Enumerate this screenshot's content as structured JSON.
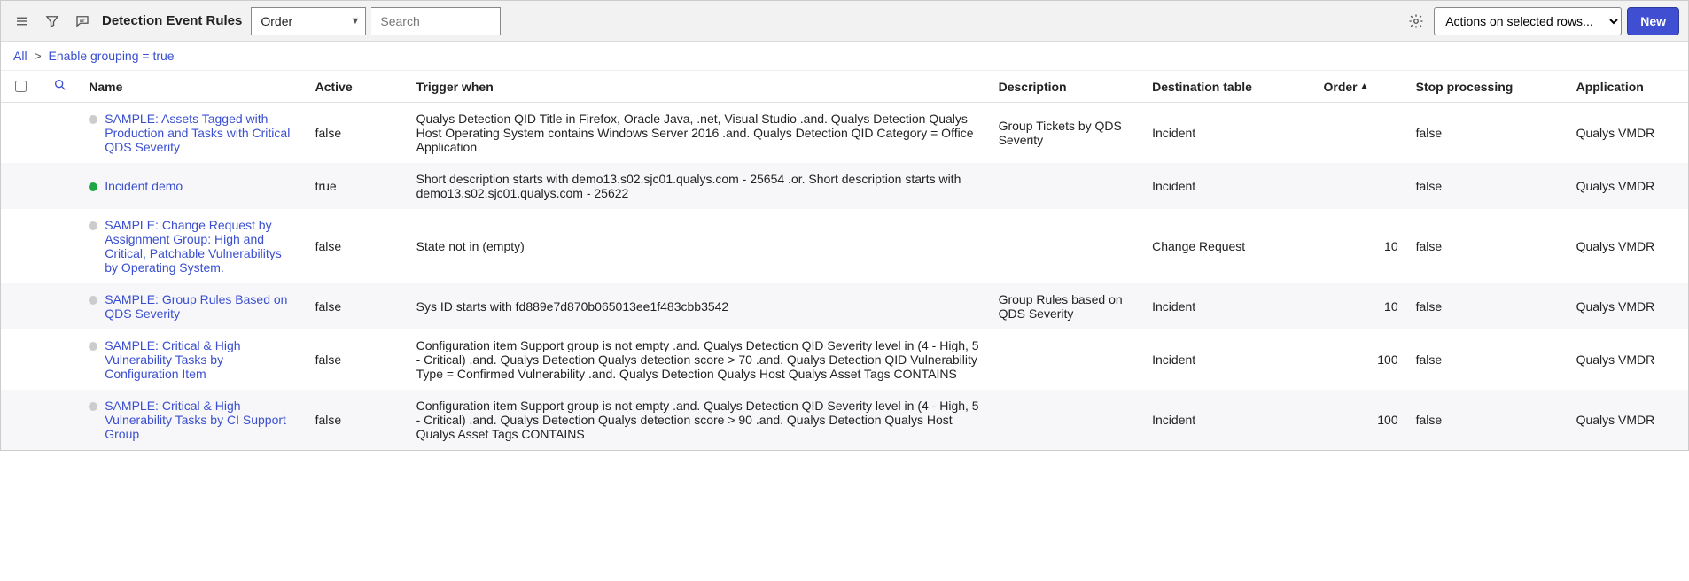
{
  "toolbar": {
    "title": "Detection Event Rules",
    "sort_field": "Order",
    "search_placeholder": "Search",
    "actions_selected": "Actions on selected rows...",
    "new_label": "New"
  },
  "breadcrumb": {
    "all": "All",
    "filter_text": "Enable grouping = true"
  },
  "columns": {
    "name": "Name",
    "active": "Active",
    "trigger": "Trigger when",
    "description": "Description",
    "destination": "Destination table",
    "order": "Order",
    "stop": "Stop processing",
    "application": "Application"
  },
  "rows": [
    {
      "active_dot": "grey",
      "name": "SAMPLE: Assets Tagged with Production and Tasks with Critical QDS Severity",
      "active": "false",
      "trigger": "Qualys Detection QID Title in Firefox, Oracle Java, .net, Visual Studio .and. Qualys Detection Qualys Host Operating System contains Windows Server 2016 .and. Qualys Detection QID Category = Office Application",
      "description": "Group Tickets by QDS Severity",
      "destination": "Incident",
      "order": "",
      "stop": "false",
      "application": "Qualys VMDR"
    },
    {
      "active_dot": "green",
      "name": "Incident demo",
      "active": "true",
      "trigger": "Short description starts with demo13.s02.sjc01.qualys.com - 25654 .or. Short description starts with demo13.s02.sjc01.qualys.com - 25622",
      "description": "",
      "destination": "Incident",
      "order": "",
      "stop": "false",
      "application": "Qualys VMDR"
    },
    {
      "active_dot": "grey",
      "name": "SAMPLE: Change Request by Assignment Group: High and Critical, Patchable Vulnerabilitys by Operating System.",
      "active": "false",
      "trigger": "State not in (empty)",
      "description": "",
      "destination": "Change Request",
      "order": "10",
      "stop": "false",
      "application": "Qualys VMDR"
    },
    {
      "active_dot": "grey",
      "name": "SAMPLE: Group Rules Based on QDS Severity",
      "active": "false",
      "trigger": "Sys ID starts with fd889e7d870b065013ee1f483cbb3542",
      "description": "Group Rules based on QDS Severity",
      "destination": "Incident",
      "order": "10",
      "stop": "false",
      "application": "Qualys VMDR"
    },
    {
      "active_dot": "grey",
      "name": "SAMPLE: Critical & High Vulnerability Tasks by Configuration Item",
      "active": "false",
      "trigger": "Configuration item Support group is not empty .and. Qualys Detection QID Severity level in (4 - High, 5 - Critical) .and. Qualys Detection Qualys detection score > 70 .and. Qualys Detection QID Vulnerability Type = Confirmed Vulnerability .and. Qualys Detection Qualys Host Qualys Asset Tags CONTAINS",
      "description": "",
      "destination": "Incident",
      "order": "100",
      "stop": "false",
      "application": "Qualys VMDR"
    },
    {
      "active_dot": "grey",
      "name": "SAMPLE: Critical & High Vulnerability Tasks by CI Support Group",
      "active": "false",
      "trigger": "Configuration item Support group is not empty .and. Qualys Detection QID Severity level in (4 - High, 5 - Critical) .and. Qualys Detection Qualys detection score > 90 .and. Qualys Detection Qualys Host Qualys Asset Tags CONTAINS",
      "description": "",
      "destination": "Incident",
      "order": "100",
      "stop": "false",
      "application": "Qualys VMDR"
    }
  ]
}
